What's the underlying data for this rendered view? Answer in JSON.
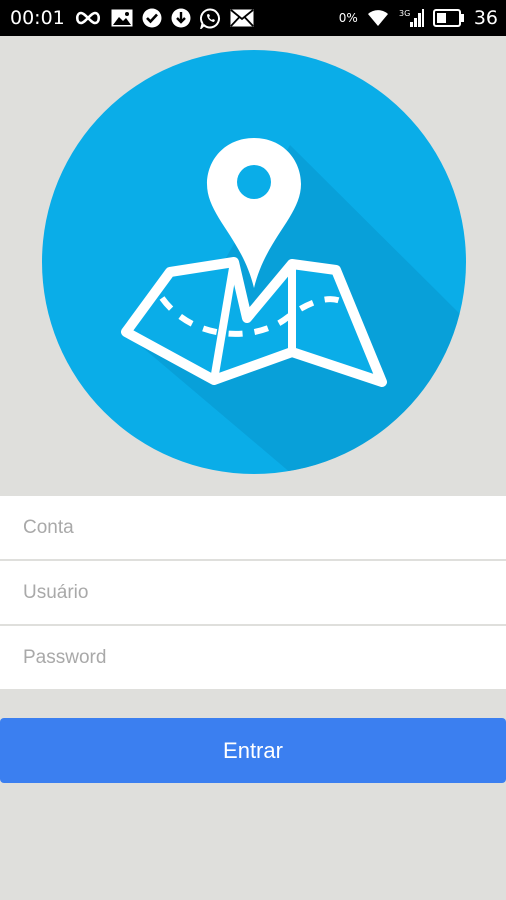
{
  "status_bar": {
    "time": "00:01",
    "data_speed": "0%",
    "battery_level": "36",
    "network": "3G",
    "left_icons": [
      "infinity-icon",
      "image-icon",
      "check-circle-icon",
      "download-icon",
      "whatsapp-icon",
      "mail-icon"
    ],
    "right_icons": [
      "wifi-icon",
      "signal-icon",
      "battery-icon"
    ]
  },
  "logo": {
    "icon": "map-pin-icon",
    "circle_color": "#0aade8"
  },
  "form": {
    "account_placeholder": "Conta",
    "user_placeholder": "Usuário",
    "password_placeholder": "Password",
    "submit_label": "Entrar",
    "button_color": "#3b7ff0"
  }
}
